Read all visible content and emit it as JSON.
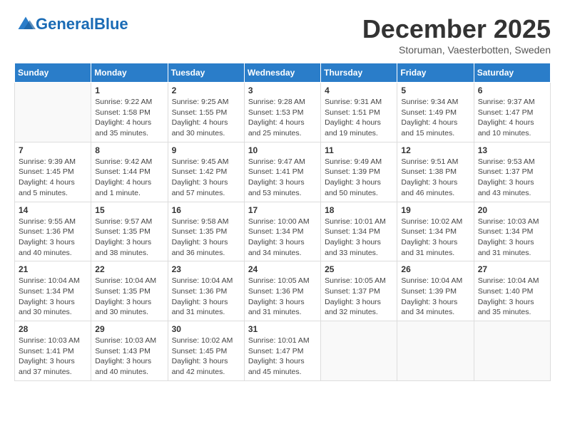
{
  "header": {
    "logo_general": "General",
    "logo_blue": "Blue",
    "month_title": "December 2025",
    "subtitle": "Storuman, Vaesterbotten, Sweden"
  },
  "days_of_week": [
    "Sunday",
    "Monday",
    "Tuesday",
    "Wednesday",
    "Thursday",
    "Friday",
    "Saturday"
  ],
  "weeks": [
    [
      {
        "day": "",
        "info": ""
      },
      {
        "day": "1",
        "info": "Sunrise: 9:22 AM\nSunset: 1:58 PM\nDaylight: 4 hours\nand 35 minutes."
      },
      {
        "day": "2",
        "info": "Sunrise: 9:25 AM\nSunset: 1:55 PM\nDaylight: 4 hours\nand 30 minutes."
      },
      {
        "day": "3",
        "info": "Sunrise: 9:28 AM\nSunset: 1:53 PM\nDaylight: 4 hours\nand 25 minutes."
      },
      {
        "day": "4",
        "info": "Sunrise: 9:31 AM\nSunset: 1:51 PM\nDaylight: 4 hours\nand 19 minutes."
      },
      {
        "day": "5",
        "info": "Sunrise: 9:34 AM\nSunset: 1:49 PM\nDaylight: 4 hours\nand 15 minutes."
      },
      {
        "day": "6",
        "info": "Sunrise: 9:37 AM\nSunset: 1:47 PM\nDaylight: 4 hours\nand 10 minutes."
      }
    ],
    [
      {
        "day": "7",
        "info": "Sunrise: 9:39 AM\nSunset: 1:45 PM\nDaylight: 4 hours\nand 5 minutes."
      },
      {
        "day": "8",
        "info": "Sunrise: 9:42 AM\nSunset: 1:44 PM\nDaylight: 4 hours\nand 1 minute."
      },
      {
        "day": "9",
        "info": "Sunrise: 9:45 AM\nSunset: 1:42 PM\nDaylight: 3 hours\nand 57 minutes."
      },
      {
        "day": "10",
        "info": "Sunrise: 9:47 AM\nSunset: 1:41 PM\nDaylight: 3 hours\nand 53 minutes."
      },
      {
        "day": "11",
        "info": "Sunrise: 9:49 AM\nSunset: 1:39 PM\nDaylight: 3 hours\nand 50 minutes."
      },
      {
        "day": "12",
        "info": "Sunrise: 9:51 AM\nSunset: 1:38 PM\nDaylight: 3 hours\nand 46 minutes."
      },
      {
        "day": "13",
        "info": "Sunrise: 9:53 AM\nSunset: 1:37 PM\nDaylight: 3 hours\nand 43 minutes."
      }
    ],
    [
      {
        "day": "14",
        "info": "Sunrise: 9:55 AM\nSunset: 1:36 PM\nDaylight: 3 hours\nand 40 minutes."
      },
      {
        "day": "15",
        "info": "Sunrise: 9:57 AM\nSunset: 1:35 PM\nDaylight: 3 hours\nand 38 minutes."
      },
      {
        "day": "16",
        "info": "Sunrise: 9:58 AM\nSunset: 1:35 PM\nDaylight: 3 hours\nand 36 minutes."
      },
      {
        "day": "17",
        "info": "Sunrise: 10:00 AM\nSunset: 1:34 PM\nDaylight: 3 hours\nand 34 minutes."
      },
      {
        "day": "18",
        "info": "Sunrise: 10:01 AM\nSunset: 1:34 PM\nDaylight: 3 hours\nand 33 minutes."
      },
      {
        "day": "19",
        "info": "Sunrise: 10:02 AM\nSunset: 1:34 PM\nDaylight: 3 hours\nand 31 minutes."
      },
      {
        "day": "20",
        "info": "Sunrise: 10:03 AM\nSunset: 1:34 PM\nDaylight: 3 hours\nand 31 minutes."
      }
    ],
    [
      {
        "day": "21",
        "info": "Sunrise: 10:04 AM\nSunset: 1:34 PM\nDaylight: 3 hours\nand 30 minutes."
      },
      {
        "day": "22",
        "info": "Sunrise: 10:04 AM\nSunset: 1:35 PM\nDaylight: 3 hours\nand 30 minutes."
      },
      {
        "day": "23",
        "info": "Sunrise: 10:04 AM\nSunset: 1:36 PM\nDaylight: 3 hours\nand 31 minutes."
      },
      {
        "day": "24",
        "info": "Sunrise: 10:05 AM\nSunset: 1:36 PM\nDaylight: 3 hours\nand 31 minutes."
      },
      {
        "day": "25",
        "info": "Sunrise: 10:05 AM\nSunset: 1:37 PM\nDaylight: 3 hours\nand 32 minutes."
      },
      {
        "day": "26",
        "info": "Sunrise: 10:04 AM\nSunset: 1:39 PM\nDaylight: 3 hours\nand 34 minutes."
      },
      {
        "day": "27",
        "info": "Sunrise: 10:04 AM\nSunset: 1:40 PM\nDaylight: 3 hours\nand 35 minutes."
      }
    ],
    [
      {
        "day": "28",
        "info": "Sunrise: 10:03 AM\nSunset: 1:41 PM\nDaylight: 3 hours\nand 37 minutes."
      },
      {
        "day": "29",
        "info": "Sunrise: 10:03 AM\nSunset: 1:43 PM\nDaylight: 3 hours\nand 40 minutes."
      },
      {
        "day": "30",
        "info": "Sunrise: 10:02 AM\nSunset: 1:45 PM\nDaylight: 3 hours\nand 42 minutes."
      },
      {
        "day": "31",
        "info": "Sunrise: 10:01 AM\nSunset: 1:47 PM\nDaylight: 3 hours\nand 45 minutes."
      },
      {
        "day": "",
        "info": ""
      },
      {
        "day": "",
        "info": ""
      },
      {
        "day": "",
        "info": ""
      }
    ]
  ]
}
